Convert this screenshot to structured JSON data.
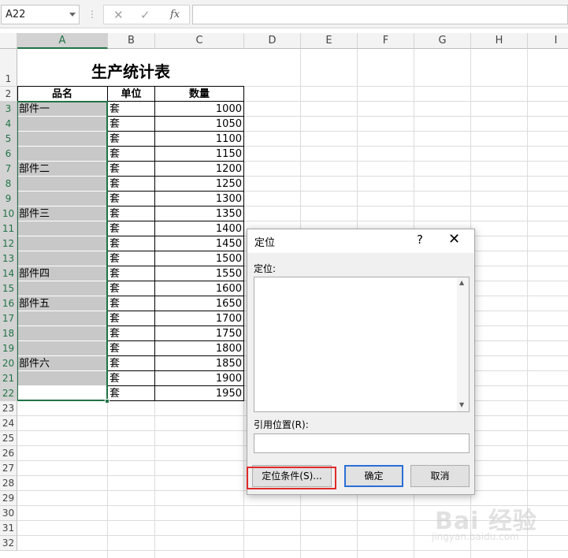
{
  "formula_bar": {
    "name_box": "A22",
    "cancel_icon": "✕",
    "enter_icon": "✓",
    "fx_label": "fx"
  },
  "columns": [
    "A",
    "B",
    "C",
    "D",
    "E",
    "F",
    "G",
    "H",
    "I"
  ],
  "rows": [
    "1",
    "2",
    "3",
    "4",
    "5",
    "6",
    "7",
    "8",
    "9",
    "10",
    "11",
    "12",
    "13",
    "14",
    "15",
    "16",
    "17",
    "18",
    "19",
    "20",
    "21",
    "22",
    "23",
    "24",
    "25",
    "26",
    "27",
    "28",
    "29",
    "30",
    "31",
    "32"
  ],
  "sheet": {
    "title": "生产统计表",
    "headers": [
      "品名",
      "单位",
      "数量"
    ],
    "data": [
      [
        "部件一",
        "套",
        "1000"
      ],
      [
        "",
        "套",
        "1050"
      ],
      [
        "",
        "套",
        "1100"
      ],
      [
        "",
        "套",
        "1150"
      ],
      [
        "部件二",
        "套",
        "1200"
      ],
      [
        "",
        "套",
        "1250"
      ],
      [
        "",
        "套",
        "1300"
      ],
      [
        "部件三",
        "套",
        "1350"
      ],
      [
        "",
        "套",
        "1400"
      ],
      [
        "",
        "套",
        "1450"
      ],
      [
        "",
        "套",
        "1500"
      ],
      [
        "部件四",
        "套",
        "1550"
      ],
      [
        "",
        "套",
        "1600"
      ],
      [
        "部件五",
        "套",
        "1650"
      ],
      [
        "",
        "套",
        "1700"
      ],
      [
        "",
        "套",
        "1750"
      ],
      [
        "",
        "套",
        "1800"
      ],
      [
        "部件六",
        "套",
        "1850"
      ],
      [
        "",
        "套",
        "1900"
      ],
      [
        "",
        "套",
        "1950"
      ]
    ]
  },
  "dialog": {
    "title": "定位",
    "help": "?",
    "close": "✕",
    "goto_label": "定位:",
    "reference_label": "引用位置(R):",
    "special_button": "定位条件(S)...",
    "ok_button": "确定",
    "cancel_button": "取消"
  },
  "watermark": {
    "logo": "Bai 经验",
    "url": "jingyan.baidu.com"
  },
  "colors": {
    "selection_accent": "#217346",
    "highlight_box": "#e02a2a",
    "selection_fill": "#c8c8c8"
  }
}
